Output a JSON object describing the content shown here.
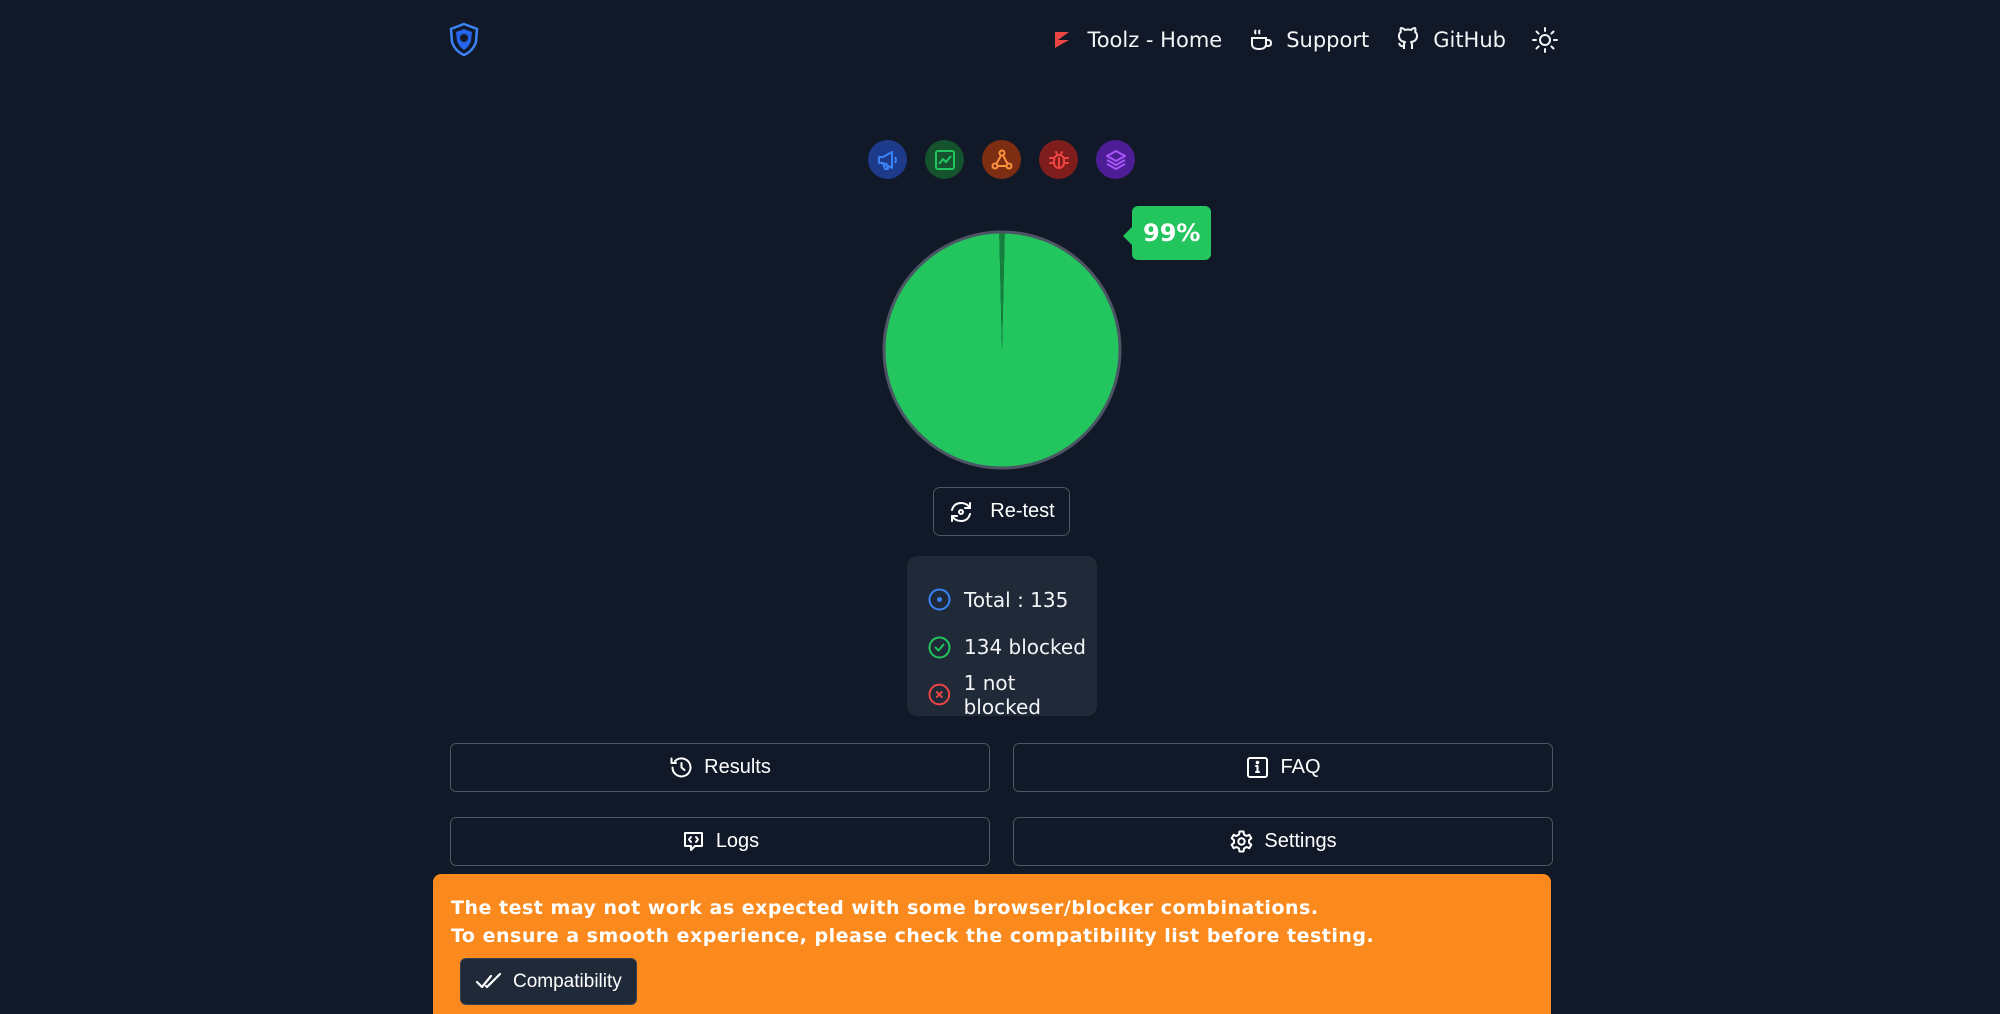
{
  "header": {
    "nav": [
      {
        "label": "Toolz - Home",
        "icon": "toolz-logo-icon"
      },
      {
        "label": "Support",
        "icon": "coffee-icon"
      },
      {
        "label": "GitHub",
        "icon": "github-icon"
      }
    ],
    "theme_toggle_icon": "sun-icon"
  },
  "categories": [
    {
      "name": "ads",
      "icon": "megaphone-icon",
      "color": "#2563eb"
    },
    {
      "name": "analytics",
      "icon": "chart-icon",
      "color": "#16a34a"
    },
    {
      "name": "tracking",
      "icon": "network-icon",
      "color": "#ea580c"
    },
    {
      "name": "error-trackers",
      "icon": "bug-icon",
      "color": "#dc2626"
    },
    {
      "name": "others",
      "icon": "layers-icon",
      "color": "#9333ea"
    }
  ],
  "chart_data": {
    "type": "pie",
    "values": [
      134,
      1
    ],
    "colors": [
      "#22c55e",
      "#15803d"
    ],
    "label": "99%"
  },
  "retest_label": "Re-test",
  "stats": {
    "total": "Total : 135",
    "blocked": "134 blocked",
    "not_blocked": "1 not blocked"
  },
  "buttons": {
    "results": "Results",
    "faq": "FAQ",
    "logs": "Logs",
    "settings": "Settings"
  },
  "banner": {
    "line1": "The test may not work as expected with some browser/blocker combinations.",
    "line2": "To ensure a smooth experience, please check the compatibility list before testing.",
    "button": "Compatibility",
    "color": "#fb8a1e"
  }
}
